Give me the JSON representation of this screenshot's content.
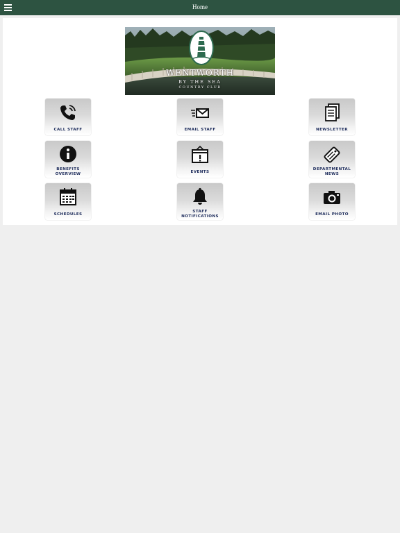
{
  "header": {
    "title": "Home",
    "menu_icon": "hamburger-menu-icon",
    "background": "#2d5341"
  },
  "hero": {
    "brand_name": "WENTWORTH",
    "brand_line2": "BY THE SEA",
    "brand_line3": "COUNTRY CLUB"
  },
  "tiles": [
    {
      "label": "CALL STAFF",
      "icon": "phone-icon"
    },
    {
      "label": "EMAIL STAFF",
      "icon": "email-icon"
    },
    {
      "label": "NEWSLETTER",
      "icon": "newsletter-icon"
    },
    {
      "label": "BENEFITS\nOVERVIEW",
      "icon": "info-icon"
    },
    {
      "label": "EVENTS",
      "icon": "events-alert-icon"
    },
    {
      "label": "DEPARTMENTAL\nNEWS",
      "icon": "news-tag-icon"
    },
    {
      "label": "SCHEDULES",
      "icon": "calendar-icon"
    },
    {
      "label": "STAFF\nNOTIFICATIONS",
      "icon": "bell-icon"
    },
    {
      "label": "EMAIL PHOTO",
      "icon": "camera-icon"
    }
  ]
}
